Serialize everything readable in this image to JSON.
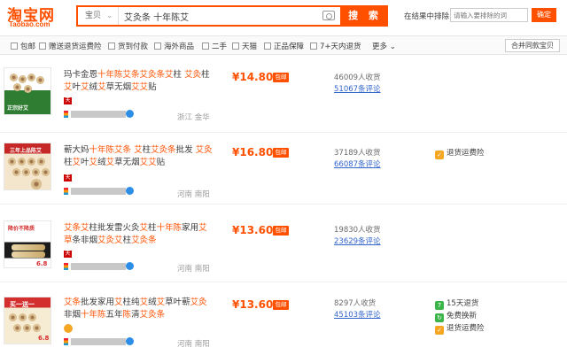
{
  "logo": {
    "cn": "淘宝网",
    "en": "Taobao.com"
  },
  "search": {
    "category": "宝贝",
    "query": "艾灸条 十年陈艾",
    "button": "搜 索"
  },
  "exclude": {
    "label": "在结果中排除",
    "placeholder": "请输入要排除的词",
    "button": "确定"
  },
  "filters": [
    "包邮",
    "赠送退货运费险",
    "货到付款",
    "海外商品",
    "二手",
    "天猫",
    "正品保障",
    "7+天内退货"
  ],
  "more": "更多",
  "merge_button": "合并同款宝贝",
  "items": [
    {
      "title_parts": [
        {
          "t": "玛卡金恩",
          "h": false
        },
        {
          "t": "十年陈艾条艾灸条艾",
          "h": true
        },
        {
          "t": "柱 ",
          "h": false
        },
        {
          "t": "艾灸",
          "h": true
        },
        {
          "t": "柱",
          "h": false
        },
        {
          "t": "艾",
          "h": true
        },
        {
          "t": "叶",
          "h": false
        },
        {
          "t": "艾",
          "h": true
        },
        {
          "t": "绒",
          "h": false
        },
        {
          "t": "艾",
          "h": true
        },
        {
          "t": "草无烟",
          "h": false
        },
        {
          "t": "艾艾",
          "h": true
        },
        {
          "t": "贴",
          "h": false
        }
      ],
      "location": "浙江 金华",
      "price": "¥14.80",
      "ship": "包邮",
      "sales": "46009人收货",
      "reviews": "51067条评论",
      "thumb_tag": "正宗好艾",
      "services": []
    },
    {
      "title_parts": [
        {
          "t": "蕲大妈",
          "h": false
        },
        {
          "t": "十年陈艾条",
          "h": true
        },
        {
          "t": " ",
          "h": false
        },
        {
          "t": "艾",
          "h": true
        },
        {
          "t": "柱",
          "h": false
        },
        {
          "t": "艾灸条",
          "h": true
        },
        {
          "t": "批发 ",
          "h": false
        },
        {
          "t": "艾灸",
          "h": true
        },
        {
          "t": "柱",
          "h": false
        },
        {
          "t": "艾",
          "h": true
        },
        {
          "t": "叶",
          "h": false
        },
        {
          "t": "艾",
          "h": true
        },
        {
          "t": "绒",
          "h": false
        },
        {
          "t": "艾",
          "h": true
        },
        {
          "t": "草无烟",
          "h": false
        },
        {
          "t": "艾艾",
          "h": true
        },
        {
          "t": "贴",
          "h": false
        }
      ],
      "location": "河南 南阳",
      "price": "¥16.80",
      "ship": "包邮",
      "sales": "37189人收货",
      "reviews": "66087条评论",
      "thumb_tag": "三年上品陈艾",
      "services": [
        {
          "icon": "orange",
          "text": "退货运费险"
        }
      ]
    },
    {
      "title_parts": [
        {
          "t": "艾条艾",
          "h": true
        },
        {
          "t": "柱批发雷火灸",
          "h": false
        },
        {
          "t": "艾",
          "h": true
        },
        {
          "t": "柱",
          "h": false
        },
        {
          "t": "十年陈",
          "h": true
        },
        {
          "t": "家用",
          "h": false
        },
        {
          "t": "艾",
          "h": true
        },
        {
          "t": "草",
          "h": true
        },
        {
          "t": "条",
          "h": false
        },
        {
          "t": "非烟",
          "h": false
        },
        {
          "t": "艾灸艾",
          "h": true
        },
        {
          "t": "柱",
          "h": false
        },
        {
          "t": "艾灸条",
          "h": true
        }
      ],
      "location": "河南 南阳",
      "price": "¥13.60",
      "ship": "包邮",
      "sales": "19830人收货",
      "reviews": "23629条评论",
      "thumb_tag": "降价不降质",
      "services": []
    },
    {
      "title_parts": [
        {
          "t": "艾条",
          "h": true
        },
        {
          "t": "批发家用",
          "h": false
        },
        {
          "t": "艾",
          "h": true
        },
        {
          "t": "柱纯",
          "h": false
        },
        {
          "t": "艾",
          "h": true
        },
        {
          "t": "绒",
          "h": false
        },
        {
          "t": "艾",
          "h": true
        },
        {
          "t": "草叶蕲",
          "h": false
        },
        {
          "t": "艾灸",
          "h": true
        },
        {
          "t": "非烟",
          "h": false
        },
        {
          "t": "十年陈",
          "h": true
        },
        {
          "t": "五年",
          "h": false
        },
        {
          "t": "陈",
          "h": true
        },
        {
          "t": "清",
          "h": false
        },
        {
          "t": "艾灸条",
          "h": true
        }
      ],
      "location": "河南 南阳",
      "price": "¥13.60",
      "ship": "包邮",
      "sales": "8297人收货",
      "reviews": "45103条评论",
      "thumb_tag": "买一送一",
      "thumb_price": "6.8",
      "services": [
        {
          "icon": "green",
          "text": "15天退货"
        },
        {
          "icon": "green",
          "text": "免费换新"
        },
        {
          "icon": "orange",
          "text": "退货运费险"
        }
      ]
    }
  ],
  "colors": {
    "accent": "#ff5000",
    "link": "#3366cc"
  }
}
